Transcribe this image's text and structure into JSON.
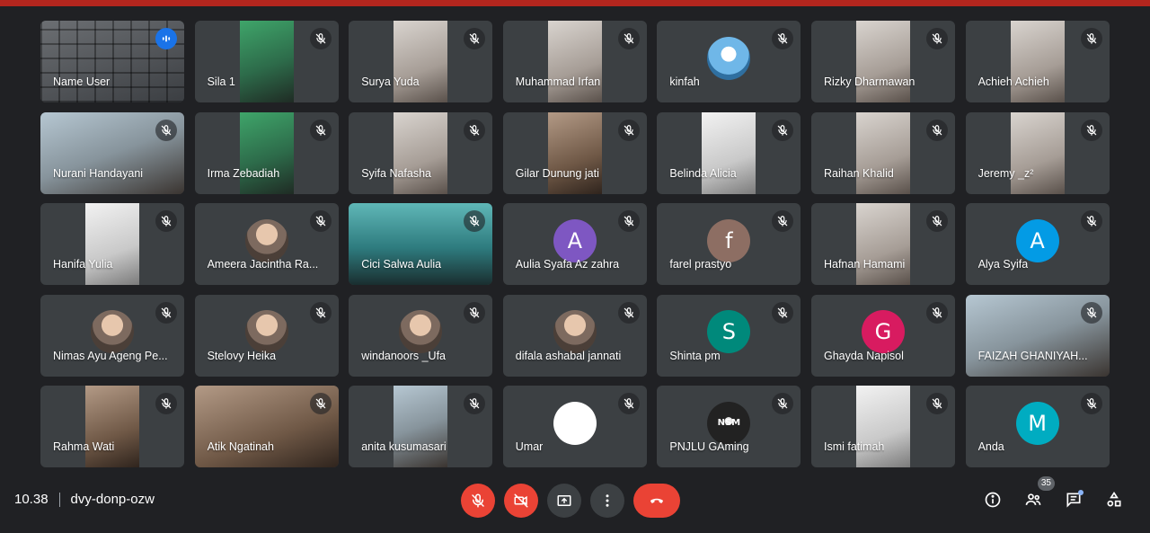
{
  "meeting": {
    "time": "10.38",
    "code": "dvy-donp-ozw",
    "participant_count": "35"
  },
  "colors": {
    "accent_red": "#ea4335",
    "tile_bg": "#3c4043",
    "bg": "#202124"
  },
  "participants": [
    {
      "name": "Name User",
      "bg": "mosaic",
      "full": true,
      "speaking": true
    },
    {
      "name": "Sila 1",
      "bg": "green"
    },
    {
      "name": "Surya Yuda",
      "bg": "light"
    },
    {
      "name": "Muhammad Irfan",
      "bg": "light"
    },
    {
      "name": "kinfah",
      "avatar": "grad"
    },
    {
      "name": "Rizky Dharmawan",
      "bg": "light"
    },
    {
      "name": "Achieh Achieh",
      "bg": "light"
    },
    {
      "name": "Nurani Handayani",
      "bg": "room",
      "full": true
    },
    {
      "name": "Irma Zebadiah",
      "bg": "green"
    },
    {
      "name": "Syifa Nafasha",
      "bg": "light"
    },
    {
      "name": "Gilar Dunung jati",
      "bg": "warm"
    },
    {
      "name": "Belinda Alicia",
      "bg": "white"
    },
    {
      "name": "Raihan Khalid",
      "bg": "light"
    },
    {
      "name": "Jeremy _z²",
      "bg": "light"
    },
    {
      "name": "Hanifa Yulia",
      "bg": "white"
    },
    {
      "name": "Ameera Jacintha Ra...",
      "avatar": "photo"
    },
    {
      "name": "Cici Salwa Aulia",
      "bg": "teal",
      "full": true
    },
    {
      "name": "Aulia Syafa Az zahra",
      "avatar": "A",
      "color": "#7e57c2"
    },
    {
      "name": "farel prastyo",
      "avatar": "f",
      "color": "#8d6e63"
    },
    {
      "name": "Hafnan Hamami",
      "bg": "light"
    },
    {
      "name": "Alya Syifa",
      "avatar": "A",
      "color": "#039be5"
    },
    {
      "name": "Nimas Ayu Ageng Pe...",
      "avatar": "photo"
    },
    {
      "name": "Stelovy Heika",
      "avatar": "photo"
    },
    {
      "name": "windanoors _Ufa",
      "avatar": "photo"
    },
    {
      "name": "difala ashabal jannati",
      "avatar": "photo"
    },
    {
      "name": "Shinta pm",
      "avatar": "S",
      "color": "#00897b"
    },
    {
      "name": "Ghayda Napisol",
      "avatar": "G",
      "color": "#d81b60"
    },
    {
      "name": "FAIZAH GHANIYAH...",
      "bg": "room",
      "full": true
    },
    {
      "name": "Rahma Wati",
      "bg": "warm"
    },
    {
      "name": "Atik Ngatinah",
      "bg": "warm",
      "full": true
    },
    {
      "name": "anita kusumasari",
      "bg": "room"
    },
    {
      "name": "Umar",
      "avatar": "white"
    },
    {
      "name": "PNJLU GAming",
      "avatar": "dark",
      "avatar_text": "NSM"
    },
    {
      "name": "Ismi fatimah",
      "bg": "white"
    },
    {
      "name": "Anda",
      "avatar": "M",
      "color": "#00acc1"
    }
  ],
  "icons": {
    "mic": "mic-off-icon",
    "camera": "camera-off-icon",
    "present": "present-icon",
    "more": "more-icon",
    "hangup": "hangup-icon",
    "info": "info-icon",
    "people": "people-icon",
    "chat": "chat-icon",
    "activities": "activities-icon"
  }
}
